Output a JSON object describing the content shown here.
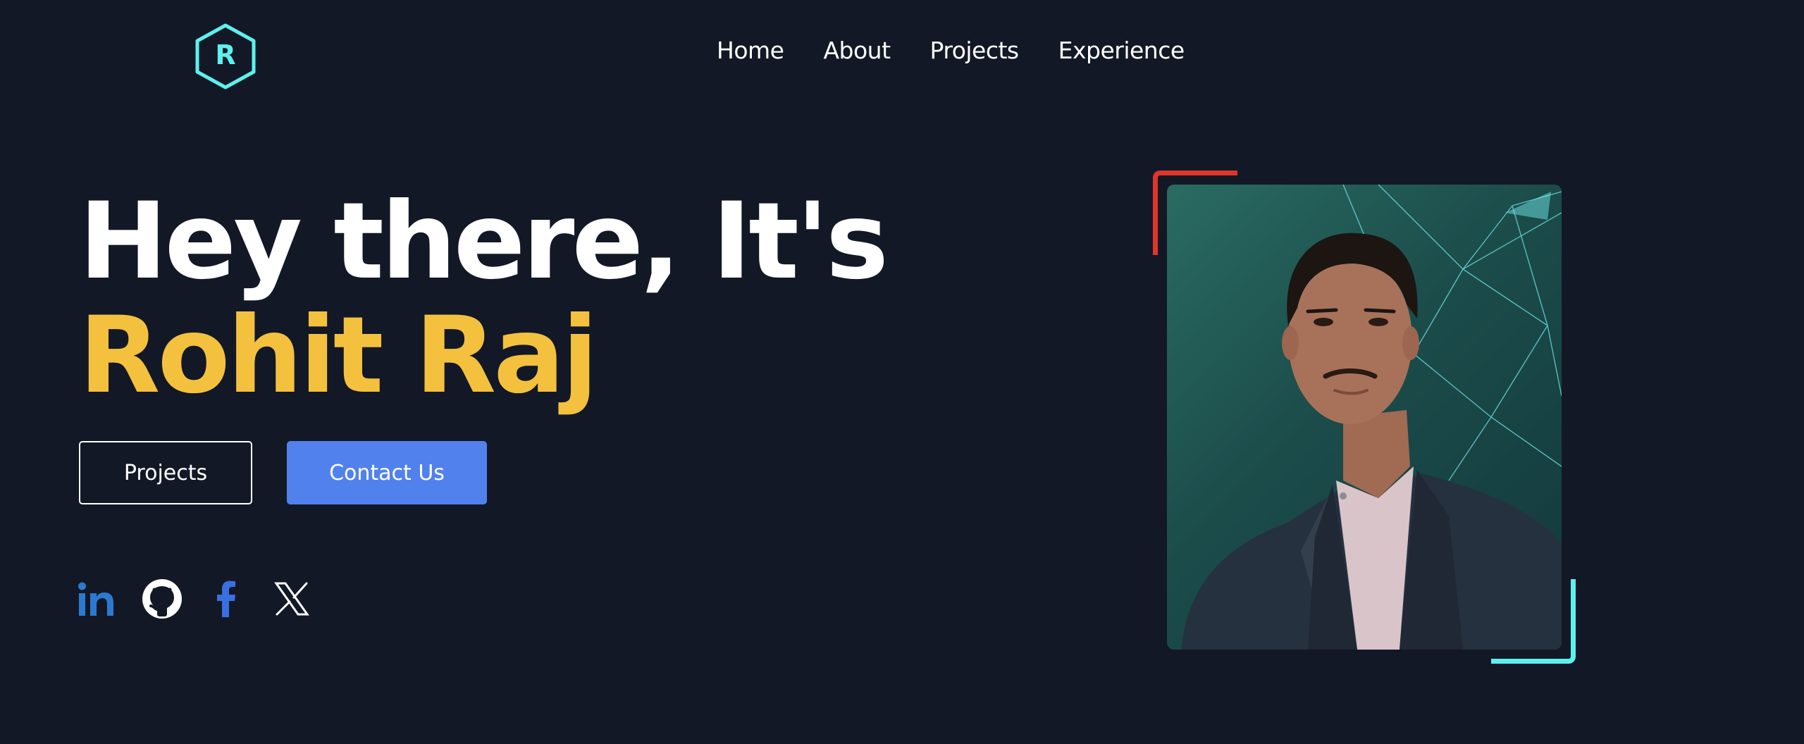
{
  "logo": {
    "letter": "R",
    "color": "#5ef0ec"
  },
  "nav": {
    "items": [
      {
        "label": "Home"
      },
      {
        "label": "About"
      },
      {
        "label": "Projects"
      },
      {
        "label": "Experience"
      }
    ]
  },
  "hero": {
    "greeting": "Hey there, It's",
    "name": "Rohit Raj",
    "name_color": "#f4c13e"
  },
  "buttons": {
    "projects_label": "Projects",
    "contact_label": "Contact Us",
    "contact_color": "#5181ec"
  },
  "social": [
    {
      "icon": "linkedin-icon"
    },
    {
      "icon": "github-icon"
    },
    {
      "icon": "facebook-icon"
    },
    {
      "icon": "x-twitter-icon"
    }
  ],
  "portrait": {
    "alt": "profile photo"
  },
  "colors": {
    "background": "#131826",
    "accent_red": "#e0352b",
    "accent_cyan": "#5ef0ec"
  }
}
